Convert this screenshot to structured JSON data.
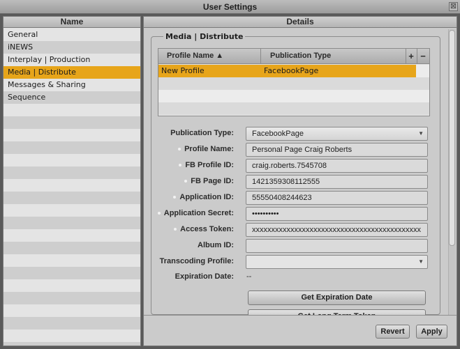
{
  "window": {
    "title": "User Settings",
    "close_glyph": "⊠"
  },
  "left_panel": {
    "header": "Name",
    "items": [
      {
        "label": "General",
        "selected": false
      },
      {
        "label": "iNEWS",
        "selected": false
      },
      {
        "label": "Interplay | Production",
        "selected": false
      },
      {
        "label": "Media | Distribute",
        "selected": true
      },
      {
        "label": "Messages & Sharing",
        "selected": false
      },
      {
        "label": "Sequence",
        "selected": false
      }
    ]
  },
  "right_panel": {
    "header": "Details",
    "group_title": "Media | Distribute",
    "profile_table": {
      "columns": [
        "Profile Name ▲",
        "Publication Type"
      ],
      "add_label": "+",
      "remove_label": "−",
      "rows": [
        {
          "profile_name": "New Profile",
          "publication_type": "FacebookPage",
          "selected": true
        }
      ]
    },
    "form": {
      "publication_type": {
        "label": "Publication Type:",
        "value": "FacebookPage"
      },
      "profile_name": {
        "label": "Profile Name:",
        "value": "Personal Page Craig Roberts"
      },
      "fb_profile_id": {
        "label": "FB Profile ID:",
        "value": "craig.roberts.7545708"
      },
      "fb_page_id": {
        "label": "FB Page ID:",
        "value": "1421359308112555"
      },
      "application_id": {
        "label": "Application ID:",
        "value": "55550408244623"
      },
      "application_secret": {
        "label": "Application Secret:",
        "value": "••••••••••"
      },
      "access_token": {
        "label": "Access Token:",
        "value": "xxxxxxxxxxxxxxxxxxxxxxxxxxxxxxxxxxxxxxxxxxxx"
      },
      "album_id": {
        "label": "Album ID:",
        "value": ""
      },
      "transcoding_profile": {
        "label": "Transcoding Profile:",
        "value": ""
      },
      "expiration_date": {
        "label": "Expiration Date:",
        "value": "--"
      }
    },
    "get_expiration_button": "Get Expiration Date",
    "get_long_term_token_button": "Get Long Term Token",
    "revert_button": "Revert",
    "apply_button": "Apply"
  },
  "colors": {
    "selection": "#e7a51a",
    "panel_bg": "#cbcbcb",
    "titlebar": "#b0b0b0"
  },
  "icons": {
    "sort_ascending": "sort-ascending-icon",
    "dropdown": "dropdown-arrow-icon",
    "required": "required-dot-icon"
  }
}
